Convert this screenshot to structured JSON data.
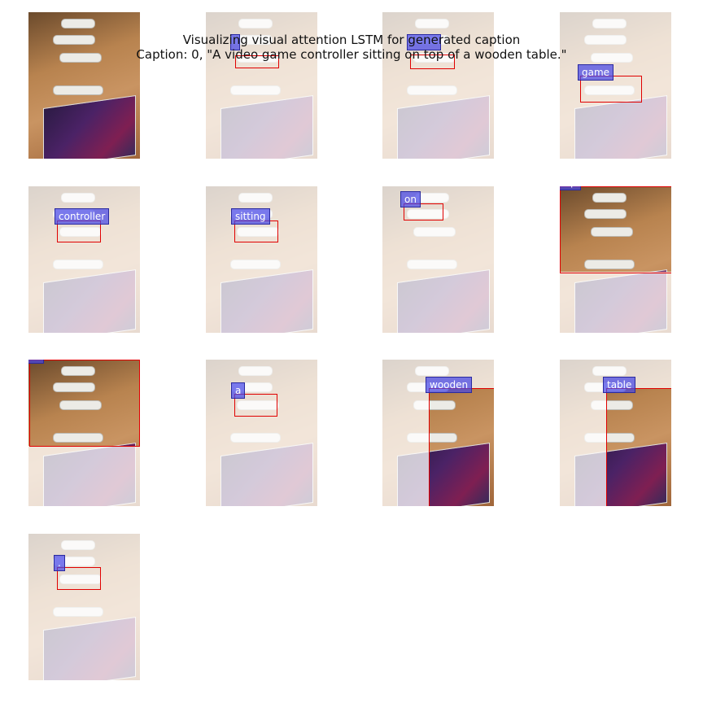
{
  "title": {
    "line1": "Visualizing visual attention LSTM for generated caption",
    "line2": "Caption: 0, \"A video game controller sitting on top of a wooden table.\""
  },
  "words": {
    "w1": "game",
    "w2": "controller",
    "w3": "sitting",
    "w4": "on",
    "w5": "top",
    "w6": "of",
    "w7": "a",
    "w8": "wooden",
    "w9": "table",
    "w10": "."
  }
}
